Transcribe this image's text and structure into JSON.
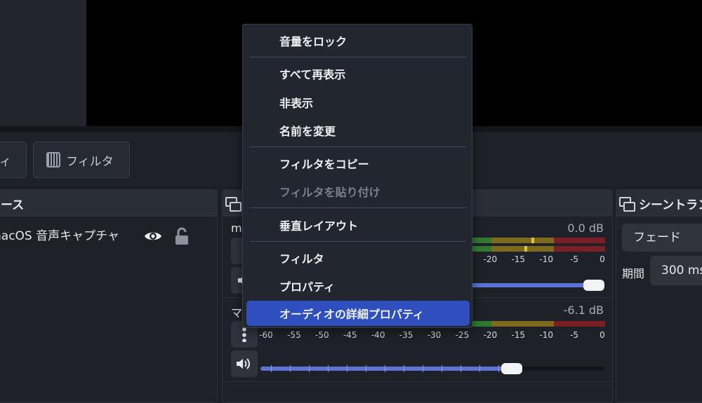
{
  "controls": {
    "properties_label": "ィ",
    "filters_label": "フィルタ"
  },
  "sources": {
    "title": "ース",
    "items": [
      {
        "label": "nacOS 音声キャプチャ"
      }
    ]
  },
  "mixer": {
    "channels": [
      {
        "name": "m",
        "db": "0.0 dB",
        "volume": 1.0
      },
      {
        "name": "マ",
        "db": "-6.1 dB",
        "volume": 0.73
      }
    ],
    "scale_ticks": [
      "-60",
      "-55",
      "-50",
      "-45",
      "-40",
      "-35",
      "-30",
      "-25",
      "-20",
      "-15",
      "-10",
      "-5",
      "0"
    ]
  },
  "transitions": {
    "title": "シーントラン",
    "selected": "フェード",
    "duration_label": "期間",
    "duration_value": "300 ms"
  },
  "context_menu": {
    "items": [
      {
        "label": "音量をロック",
        "disabled": false,
        "highlighted": false
      },
      {
        "label": "すべて再表示",
        "disabled": false,
        "highlighted": false
      },
      {
        "label": "非表示",
        "disabled": false,
        "highlighted": false
      },
      {
        "label": "名前を変更",
        "disabled": false,
        "highlighted": false
      },
      {
        "label": "フィルタをコピー",
        "disabled": false,
        "highlighted": false
      },
      {
        "label": "フィルタを貼り付け",
        "disabled": true,
        "highlighted": false
      },
      {
        "label": "垂直レイアウト",
        "disabled": false,
        "highlighted": false
      },
      {
        "label": "フィルタ",
        "disabled": false,
        "highlighted": false
      },
      {
        "label": "プロパティ",
        "disabled": false,
        "highlighted": false
      },
      {
        "label": "オーディオの詳細プロパティ",
        "disabled": false,
        "highlighted": true
      }
    ]
  },
  "colors": {
    "accent": "#2f4fbf",
    "slider_fill": "#5b72d6",
    "meter_green": "#2f7a2e",
    "meter_yellow": "#7e6a1c",
    "meter_red": "#7a1f25"
  }
}
